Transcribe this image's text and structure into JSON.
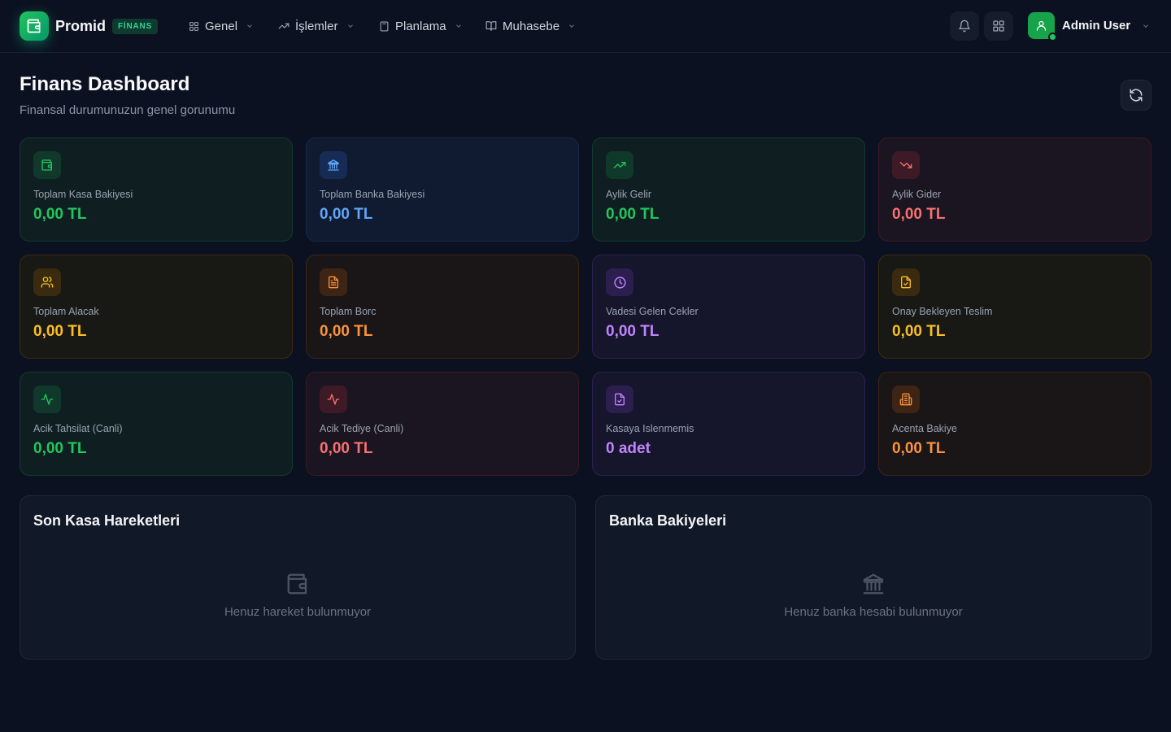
{
  "header": {
    "brand_name": "Promid",
    "brand_badge": "FİNANS",
    "nav": [
      {
        "label": "Genel",
        "icon": "grid-icon"
      },
      {
        "label": "İşlemler",
        "icon": "trending-up-icon"
      },
      {
        "label": "Planlama",
        "icon": "calculator-icon"
      },
      {
        "label": "Muhasebe",
        "icon": "book-open-icon"
      }
    ],
    "user_name": "Admin User"
  },
  "page": {
    "title": "Finans Dashboard",
    "subtitle": "Finansal durumunuzun genel gorunumu"
  },
  "cards": [
    {
      "label": "Toplam Kasa Bakiyesi",
      "value": "0,00 TL",
      "icon": "wallet-icon",
      "tone": "green",
      "color": "#22c55e"
    },
    {
      "label": "Toplam Banka Bakiyesi",
      "value": "0,00 TL",
      "icon": "bank-icon",
      "tone": "blue",
      "color": "#60a5fa"
    },
    {
      "label": "Aylik Gelir",
      "value": "0,00 TL",
      "icon": "trending-up-icon",
      "tone": "green",
      "color": "#22c55e"
    },
    {
      "label": "Aylik Gider",
      "value": "0,00 TL",
      "icon": "trending-down-icon",
      "tone": "red",
      "color": "#f87171"
    },
    {
      "label": "Toplam Alacak",
      "value": "0,00 TL",
      "icon": "users-icon",
      "tone": "yellow",
      "color": "#fbbf24"
    },
    {
      "label": "Toplam Borc",
      "value": "0,00 TL",
      "icon": "file-text-icon",
      "tone": "orange",
      "color": "#fb923c"
    },
    {
      "label": "Vadesi Gelen Cekler",
      "value": "0,00 TL",
      "icon": "clock-icon",
      "tone": "purple",
      "color": "#c084fc"
    },
    {
      "label": "Onay Bekleyen Teslim",
      "value": "0,00 TL",
      "icon": "file-check-icon",
      "tone": "yellow",
      "color": "#fbbf24"
    },
    {
      "label": "Acik Tahsilat (Canli)",
      "value": "0,00 TL",
      "icon": "activity-icon",
      "tone": "green",
      "color": "#22c55e"
    },
    {
      "label": "Acik Tediye (Canli)",
      "value": "0,00 TL",
      "icon": "activity-icon",
      "tone": "red",
      "color": "#f87171"
    },
    {
      "label": "Kasaya Islenmemis",
      "value": "0 adet",
      "icon": "file-check-icon",
      "tone": "purple",
      "color": "#c084fc"
    },
    {
      "label": "Acenta Bakiye",
      "value": "0,00 TL",
      "icon": "building-icon",
      "tone": "orange",
      "color": "#fb923c"
    }
  ],
  "panels": {
    "cash": {
      "title": "Son Kasa Hareketleri",
      "empty_text": "Henuz hareket bulunmuyor",
      "icon": "wallet-icon"
    },
    "bank": {
      "title": "Banka Bakiyeleri",
      "empty_text": "Henuz banka hesabi bulunmuyor",
      "icon": "bank-icon"
    }
  }
}
